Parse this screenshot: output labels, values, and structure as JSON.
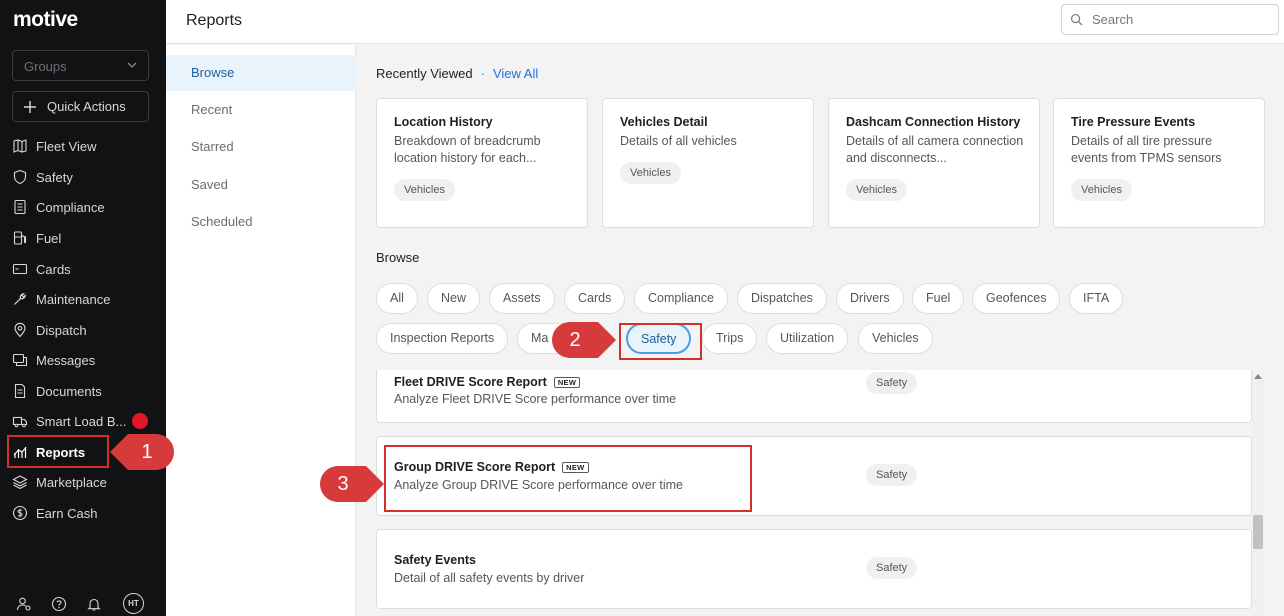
{
  "colors": {
    "sidebar_bg": "#111214",
    "accent": "#1a73e8",
    "active_bg": "#e8f3fc",
    "annotation": "#d32f2f",
    "notification": "#e2182a"
  },
  "sidebar": {
    "logo": "motive",
    "groups_placeholder": "Groups",
    "quick_actions": "Quick Actions",
    "items": [
      {
        "label": "Fleet View",
        "icon": "map-icon"
      },
      {
        "label": "Safety",
        "icon": "shield-icon"
      },
      {
        "label": "Compliance",
        "icon": "document-list-icon"
      },
      {
        "label": "Fuel",
        "icon": "fuel-icon"
      },
      {
        "label": "Cards",
        "icon": "card-icon"
      },
      {
        "label": "Maintenance",
        "icon": "wrench-icon"
      },
      {
        "label": "Dispatch",
        "icon": "location-pin-icon"
      },
      {
        "label": "Messages",
        "icon": "messages-icon"
      },
      {
        "label": "Documents",
        "icon": "document-icon"
      },
      {
        "label": "Smart Load B...",
        "icon": "truck-icon"
      },
      {
        "label": "Reports",
        "icon": "bar-chart-icon",
        "active": true
      },
      {
        "label": "Marketplace",
        "icon": "layers-icon"
      },
      {
        "label": "Earn Cash",
        "icon": "dollar-circle-icon"
      }
    ],
    "bottom": {
      "avatar": "HT"
    }
  },
  "header": {
    "title": "Reports",
    "search_placeholder": "Search"
  },
  "subnav": {
    "items": [
      "Browse",
      "Recent",
      "Starred",
      "Saved",
      "Scheduled"
    ],
    "active": "Browse"
  },
  "recent": {
    "heading": "Recently Viewed",
    "separator": "·",
    "view_all": "View All",
    "cards": [
      {
        "title": "Location History",
        "desc": "Breakdown of breadcrumb location history for each...",
        "tag": "Vehicles"
      },
      {
        "title": "Vehicles Detail",
        "desc": "Details of all vehicles",
        "tag": "Vehicles"
      },
      {
        "title": "Dashcam Connection History",
        "desc": "Details of all camera connection and disconnects...",
        "tag": "Vehicles"
      },
      {
        "title": "Tire Pressure Events",
        "desc": "Details of all tire pressure events from TPMS sensors",
        "tag": "Vehicles"
      }
    ]
  },
  "browse": {
    "heading": "Browse",
    "chips": [
      "All",
      "New",
      "Assets",
      "Cards",
      "Compliance",
      "Dispatches",
      "Drivers",
      "Fuel",
      "Geofences",
      "IFTA",
      "Inspection Reports",
      "Ma",
      "Safety",
      "Trips",
      "Utilization",
      "Vehicles"
    ],
    "active_chip": "Safety"
  },
  "reports": [
    {
      "title": "Fleet DRIVE Score Report",
      "badge": "NEW",
      "desc": "Analyze Fleet DRIVE Score performance over time",
      "tag": "Safety"
    },
    {
      "title": "Group DRIVE Score Report",
      "badge": "NEW",
      "desc": "Analyze Group DRIVE Score performance over time",
      "tag": "Safety"
    },
    {
      "title": "Safety Events",
      "badge": "",
      "desc": "Detail of all safety events by driver",
      "tag": "Safety"
    }
  ],
  "annotations": {
    "step1": "1",
    "step2": "2",
    "step3": "3"
  }
}
